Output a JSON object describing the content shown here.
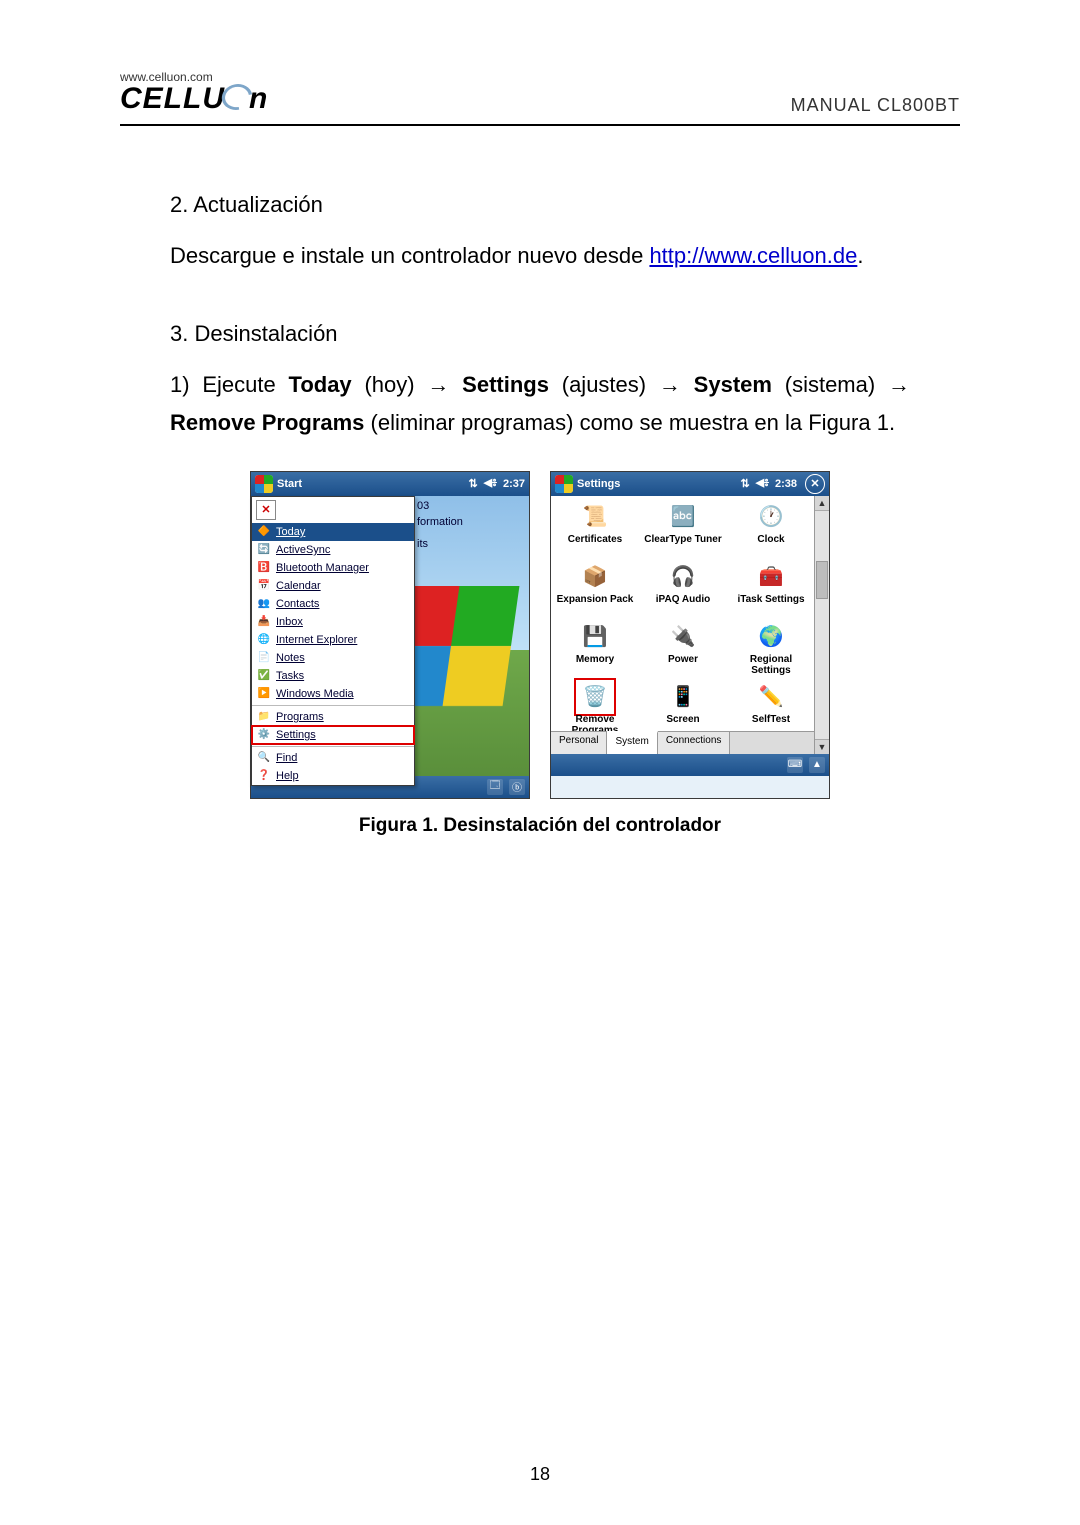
{
  "header": {
    "brand_url": "www.celluon.com",
    "brand_name": "CELLUON",
    "manual_label": "MANUAL CL800BT"
  },
  "sections": {
    "actualizacion_heading": "2. Actualización",
    "actualizacion_pre": "Descargue e instale un controlador nuevo desde ",
    "actualizacion_link": "http://www.celluon.de",
    "actualizacion_post": ".",
    "desinstalacion_heading": "3. Desinstalación",
    "step1_pre": "1) Ejecute ",
    "step1_b1": "Today",
    "step1_p1": " (hoy) → ",
    "step1_b2": "Settings",
    "step1_p2": " (ajustes) → ",
    "step1_b3": "System",
    "step1_p3": " (sistema) → ",
    "step1_b4": "Remove Programs",
    "step1_p4": " (eliminar programas) como se muestra en la Figura 1."
  },
  "figure": {
    "caption": "Figura 1. Desinstalación del controlador",
    "start_screen": {
      "title": "Start",
      "time": "2:37",
      "fragments": [
        "03",
        "formation",
        "its"
      ],
      "menu": [
        {
          "icon": "🟥",
          "label": "",
          "special": "topico"
        },
        {
          "icon": "🔶",
          "label": "Today",
          "highlight": true
        },
        {
          "icon": "🔄",
          "label": "ActiveSync"
        },
        {
          "icon": "🅱️",
          "label": "Bluetooth Manager"
        },
        {
          "icon": "📅",
          "label": "Calendar"
        },
        {
          "icon": "👥",
          "label": "Contacts"
        },
        {
          "icon": "📥",
          "label": "Inbox"
        },
        {
          "icon": "🌐",
          "label": "Internet Explorer"
        },
        {
          "icon": "📄",
          "label": "Notes"
        },
        {
          "icon": "✅",
          "label": "Tasks"
        },
        {
          "icon": "▶️",
          "label": "Windows Media"
        },
        {
          "icon": "📁",
          "label": "Programs",
          "sep": true
        },
        {
          "icon": "⚙️",
          "label": "Settings",
          "boxed": true
        },
        {
          "icon": "🔍",
          "label": "Find",
          "sep": true
        },
        {
          "icon": "❓",
          "label": "Help"
        }
      ]
    },
    "settings_screen": {
      "title": "Settings",
      "time": "2:38",
      "tabs": [
        "Personal",
        "System",
        "Connections"
      ],
      "active_tab": "System",
      "items": [
        {
          "icon": "📜",
          "label": "Certificates"
        },
        {
          "icon": "🔤",
          "label": "ClearType Tuner"
        },
        {
          "icon": "🕐",
          "label": "Clock"
        },
        {
          "icon": "📦",
          "label": "Expansion Pack"
        },
        {
          "icon": "🎧",
          "label": "iPAQ Audio"
        },
        {
          "icon": "🧰",
          "label": "iTask Settings"
        },
        {
          "icon": "💾",
          "label": "Memory"
        },
        {
          "icon": "🔌",
          "label": "Power"
        },
        {
          "icon": "🌍",
          "label": "Regional Settings"
        },
        {
          "icon": "🗑️",
          "label": "Remove Programs",
          "boxed": true
        },
        {
          "icon": "📱",
          "label": "Screen"
        },
        {
          "icon": "✏️",
          "label": "SelfTest"
        }
      ]
    }
  },
  "page_number": "18"
}
